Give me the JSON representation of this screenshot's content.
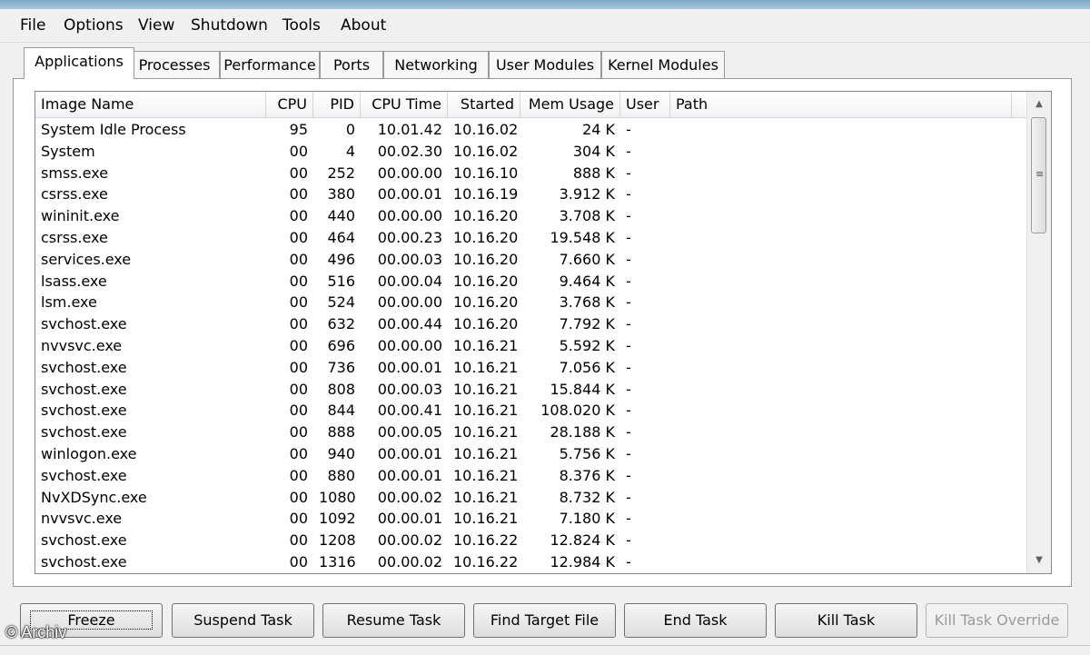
{
  "menu": [
    "File",
    "Options",
    "View",
    "Shutdown",
    "Tools",
    "About"
  ],
  "tabs": [
    "Applications",
    "Processes",
    "Performance",
    "Ports",
    "Networking",
    "User Modules",
    "Kernel Modules"
  ],
  "active_tab": "Applications",
  "columns": [
    "Image Name",
    "CPU",
    "PID",
    "CPU Time",
    "Started",
    "Mem Usage",
    "User",
    "Path"
  ],
  "rows": [
    [
      "System Idle Process",
      "95",
      "0",
      "10.01.42",
      "10.16.02",
      "24 K",
      "-",
      ""
    ],
    [
      "System",
      "00",
      "4",
      "00.02.30",
      "10.16.02",
      "304 K",
      "-",
      ""
    ],
    [
      "smss.exe",
      "00",
      "252",
      "00.00.00",
      "10.16.10",
      "888 K",
      "-",
      ""
    ],
    [
      "csrss.exe",
      "00",
      "380",
      "00.00.01",
      "10.16.19",
      "3.912 K",
      "-",
      ""
    ],
    [
      "wininit.exe",
      "00",
      "440",
      "00.00.00",
      "10.16.20",
      "3.708 K",
      "-",
      ""
    ],
    [
      "csrss.exe",
      "00",
      "464",
      "00.00.23",
      "10.16.20",
      "19.548 K",
      "-",
      ""
    ],
    [
      "services.exe",
      "00",
      "496",
      "00.00.03",
      "10.16.20",
      "7.660 K",
      "-",
      ""
    ],
    [
      "lsass.exe",
      "00",
      "516",
      "00.00.04",
      "10.16.20",
      "9.464 K",
      "-",
      ""
    ],
    [
      "lsm.exe",
      "00",
      "524",
      "00.00.00",
      "10.16.20",
      "3.768 K",
      "-",
      ""
    ],
    [
      "svchost.exe",
      "00",
      "632",
      "00.00.44",
      "10.16.20",
      "7.792 K",
      "-",
      ""
    ],
    [
      "nvvsvc.exe",
      "00",
      "696",
      "00.00.00",
      "10.16.21",
      "5.592 K",
      "-",
      ""
    ],
    [
      "svchost.exe",
      "00",
      "736",
      "00.00.01",
      "10.16.21",
      "7.056 K",
      "-",
      ""
    ],
    [
      "svchost.exe",
      "00",
      "808",
      "00.00.03",
      "10.16.21",
      "15.844 K",
      "-",
      ""
    ],
    [
      "svchost.exe",
      "00",
      "844",
      "00.00.41",
      "10.16.21",
      "108.020 K",
      "-",
      ""
    ],
    [
      "svchost.exe",
      "00",
      "888",
      "00.00.05",
      "10.16.21",
      "28.188 K",
      "-",
      ""
    ],
    [
      "winlogon.exe",
      "00",
      "940",
      "00.00.01",
      "10.16.21",
      "5.756 K",
      "-",
      ""
    ],
    [
      "svchost.exe",
      "00",
      "880",
      "00.00.01",
      "10.16.21",
      "8.376 K",
      "-",
      ""
    ],
    [
      "NvXDSync.exe",
      "00",
      "1080",
      "00.00.02",
      "10.16.21",
      "8.732 K",
      "-",
      ""
    ],
    [
      "nvvsvc.exe",
      "00",
      "1092",
      "00.00.01",
      "10.16.21",
      "7.180 K",
      "-",
      ""
    ],
    [
      "svchost.exe",
      "00",
      "1208",
      "00.00.02",
      "10.16.22",
      "12.824 K",
      "-",
      ""
    ],
    [
      "svchost.exe",
      "00",
      "1316",
      "00.00.02",
      "10.16.22",
      "12.984 K",
      "-",
      ""
    ]
  ],
  "buttons": [
    "Freeze",
    "Suspend Task",
    "Resume Task",
    "Find Target File",
    "End Task",
    "Kill Task",
    "Kill Task Override"
  ],
  "watermark": "© Archiv",
  "icons": {
    "scroll_up": "triangle-up-icon",
    "scroll_down": "triangle-down-icon",
    "grip": "scroll-grip-icon"
  }
}
